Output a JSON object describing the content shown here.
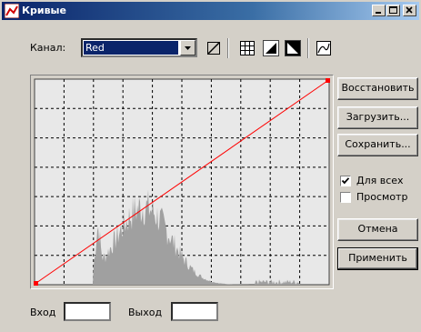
{
  "window": {
    "title": "Кривые"
  },
  "channel": {
    "label": "Канал:",
    "value": "Red"
  },
  "tools": [
    "curve-pencil-icon",
    "grid-icon",
    "dark-triangle-icon",
    "light-triangle-icon",
    "smooth-curve-icon"
  ],
  "buttons": {
    "reset": "Восстановить",
    "load": "Загрузить...",
    "save": "Сохранить...",
    "cancel": "Отмена",
    "apply": "Применить"
  },
  "checkboxes": {
    "all_channels": {
      "label": "Для всех",
      "checked": true
    },
    "preview": {
      "label": "Просмотр",
      "checked": false
    }
  },
  "inputs": {
    "input": {
      "label": "Вход",
      "value": ""
    },
    "output": {
      "label": "Выход",
      "value": ""
    }
  },
  "colors": {
    "curve": "#ff0000",
    "histogram": "#a0a0a0",
    "title_bar": "#0a246a"
  }
}
